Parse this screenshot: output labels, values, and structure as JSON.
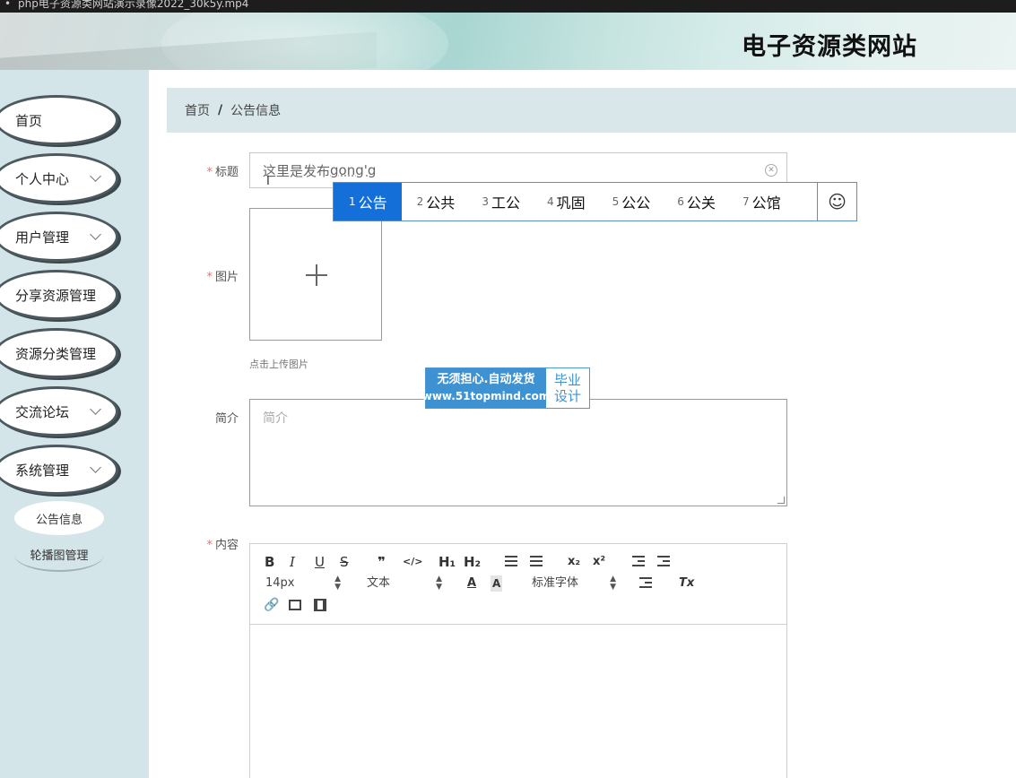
{
  "window": {
    "title": "php电子资源类网站演示录像2022_30k5y.mp4"
  },
  "header": {
    "site_title": "电子资源类网站"
  },
  "sidebar": {
    "items": [
      {
        "label": "首页",
        "has_submenu": false
      },
      {
        "label": "个人中心",
        "has_submenu": true
      },
      {
        "label": "用户管理",
        "has_submenu": true
      },
      {
        "label": "分享资源管理",
        "has_submenu": true
      },
      {
        "label": "资源分类管理",
        "has_submenu": true
      },
      {
        "label": "交流论坛",
        "has_submenu": true
      },
      {
        "label": "系统管理",
        "has_submenu": true
      }
    ],
    "subitems": [
      {
        "label": "公告信息",
        "active": true
      },
      {
        "label": "轮播图管理",
        "active": false
      }
    ]
  },
  "breadcrumb": {
    "home": "首页",
    "separator": "/",
    "current": "公告信息"
  },
  "form": {
    "title": {
      "label": "标题",
      "required_mark": "*",
      "value_prefix": "这里是发布",
      "value_composing": "gong'g"
    },
    "image": {
      "label": "图片",
      "required_mark": "*",
      "hint": "点击上传图片"
    },
    "intro": {
      "label": "简介",
      "placeholder": "简介"
    },
    "content": {
      "label": "内容",
      "required_mark": "*"
    }
  },
  "ime": {
    "candidates": [
      {
        "n": "1",
        "text": "公告"
      },
      {
        "n": "2",
        "text": "公共"
      },
      {
        "n": "3",
        "text": "工公"
      },
      {
        "n": "4",
        "text": "巩固"
      },
      {
        "n": "5",
        "text": "公公"
      },
      {
        "n": "6",
        "text": "公关"
      },
      {
        "n": "7",
        "text": "公馆"
      }
    ],
    "emoji_glyph": "☺"
  },
  "watermark": {
    "slogan": "无须担心.自动发货",
    "url": "www.51topmind.com",
    "tag_line1": "毕业",
    "tag_line2": "设计"
  },
  "editor": {
    "font_size": "14px",
    "block_type": "文本",
    "font_family": "标准字体",
    "buttons": {
      "bold": "B",
      "italic": "I",
      "underline": "U",
      "strike": "S",
      "quote": "❞",
      "code": "</>",
      "h1": "H₁",
      "h2": "H₂",
      "sub": "x₂",
      "sup": "x²",
      "clean": "Tx"
    }
  },
  "colors": {
    "sidebar_bg": "#d3e5e8",
    "breadcrumb_bg": "#d9e7ea",
    "ime_selected": "#1470d8",
    "required": "#f56c6c",
    "watermark_blue": "#3f92d1"
  }
}
